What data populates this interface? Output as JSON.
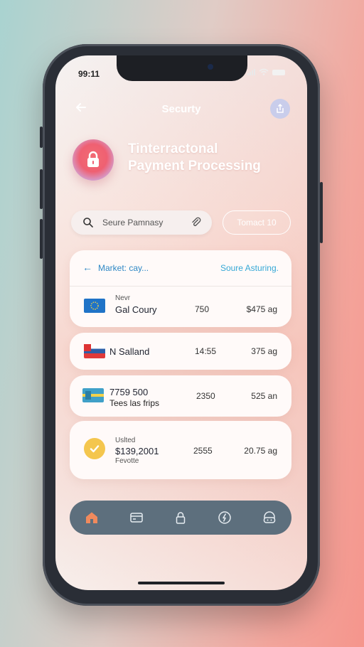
{
  "status_bar": {
    "time": "99:11"
  },
  "header": {
    "title": "Securty"
  },
  "hero": {
    "title_line1": "Tinterractonal",
    "title_line2": "Payment Processing"
  },
  "search": {
    "placeholder": "Seure Pamnasy"
  },
  "contact_button": {
    "label": "Tomact 10"
  },
  "list": {
    "header_left": "Market: cay...",
    "header_right": "Soure Asturing.",
    "rows": [
      {
        "kicker": "Nevr",
        "title": "Gal Coury",
        "amount1": "750",
        "amount2": "$475 ag"
      },
      {
        "title": "N Salland",
        "amount1": "14:55",
        "amount2": "375 ag"
      },
      {
        "title": "7759 500",
        "subtitle": "Tees las frips",
        "amount1": "2350",
        "amount2": "525 an"
      },
      {
        "kicker": "Uslted",
        "title": "$139,2001",
        "subtitle": "Fevotte",
        "amount1": "2555",
        "amount2": "20.75 ag"
      }
    ]
  },
  "tabbar": {
    "icons": [
      "home-icon",
      "card-icon",
      "lock-icon",
      "compass-icon",
      "support-icon"
    ],
    "active": "home-icon",
    "active_color": "#f08a5d",
    "inactive_color": "#e7edf2"
  }
}
